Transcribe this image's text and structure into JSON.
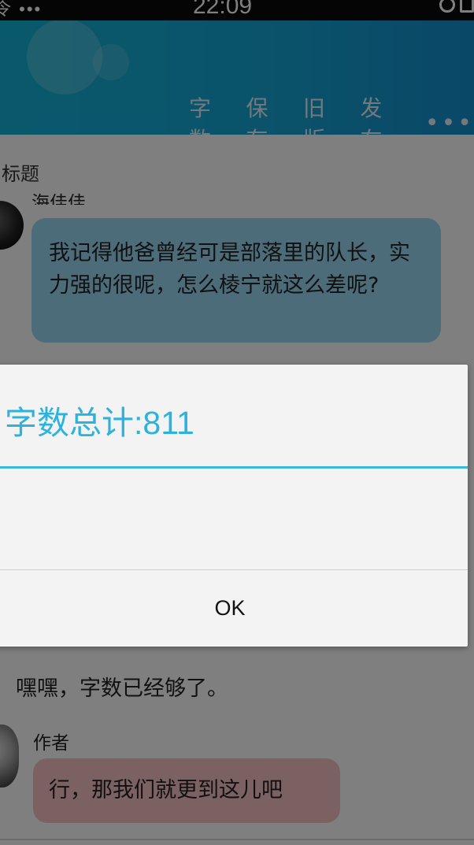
{
  "status_bar": {
    "left_text": "令 •••",
    "time": "22:09"
  },
  "toolbar": {
    "word_count_label": "字数",
    "save_label": "保存",
    "old_version_label": "旧版",
    "publish_label": "发布",
    "more_label": "•••"
  },
  "title_placeholder": "标题",
  "chat": {
    "first_sender": "海佳佳",
    "first_message": "我记得他爸曾经可是部落里的队长，实力强的很呢，怎么棱宁就这么差呢?",
    "plain_message": "嘿嘿，字数已经够了。",
    "author_label": "作者",
    "author_message": "行，那我们就更到这儿吧"
  },
  "dialog": {
    "title": "字数总计:811",
    "ok_label": "OK"
  },
  "colors": {
    "header_accent": "#15a7d6",
    "dialog_title": "#2bb2dd",
    "bubble_blue": "#9bd8f3",
    "bubble_pink": "#f6c3c3"
  }
}
